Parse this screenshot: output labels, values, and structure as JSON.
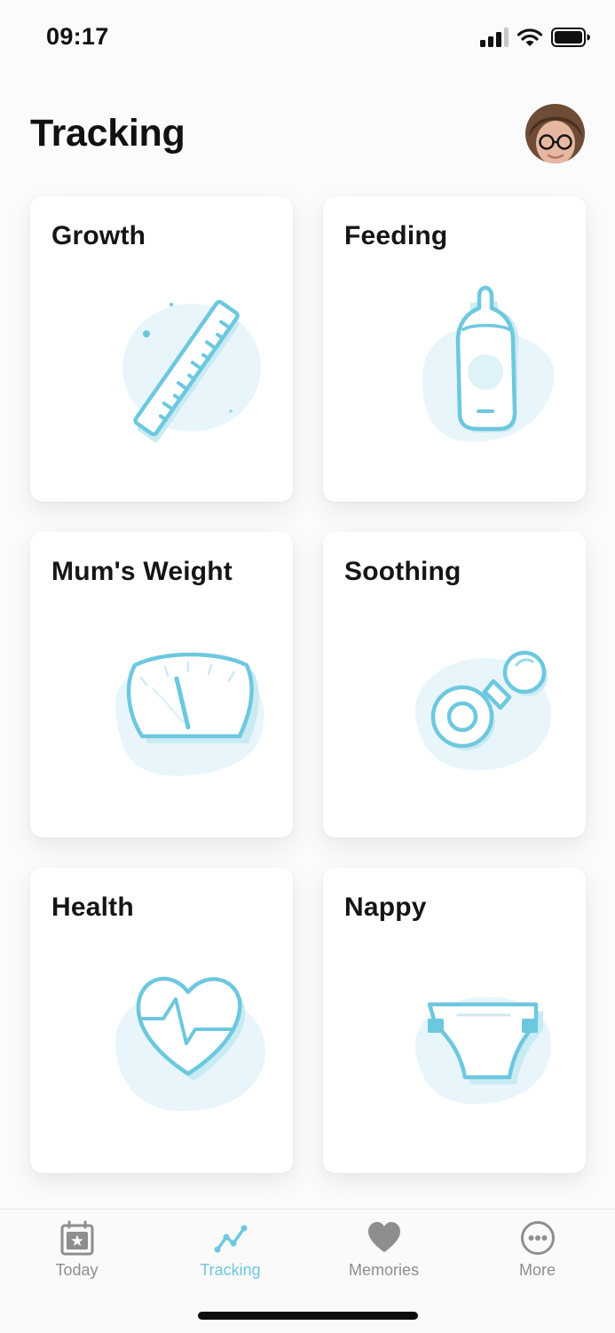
{
  "status_bar": {
    "time": "09:17"
  },
  "page": {
    "title": "Tracking"
  },
  "cards": [
    {
      "label": "Growth",
      "icon": "ruler-icon"
    },
    {
      "label": "Feeding",
      "icon": "baby-bottle-icon"
    },
    {
      "label": "Mum's Weight",
      "icon": "scale-icon"
    },
    {
      "label": "Soothing",
      "icon": "pacifier-icon"
    },
    {
      "label": "Health",
      "icon": "heart-icon"
    },
    {
      "label": "Nappy",
      "icon": "nappy-icon"
    }
  ],
  "tabs": [
    {
      "label": "Today",
      "icon": "calendar-star-icon",
      "active": false
    },
    {
      "label": "Tracking",
      "icon": "trend-line-icon",
      "active": true
    },
    {
      "label": "Memories",
      "icon": "heart-icon",
      "active": false
    },
    {
      "label": "More",
      "icon": "more-dots-icon",
      "active": false
    }
  ],
  "colors": {
    "accent": "#6dc8df",
    "blob": "#e8f6fb",
    "tab_inactive": "#8e8e8e",
    "card_background": "#ffffff"
  }
}
